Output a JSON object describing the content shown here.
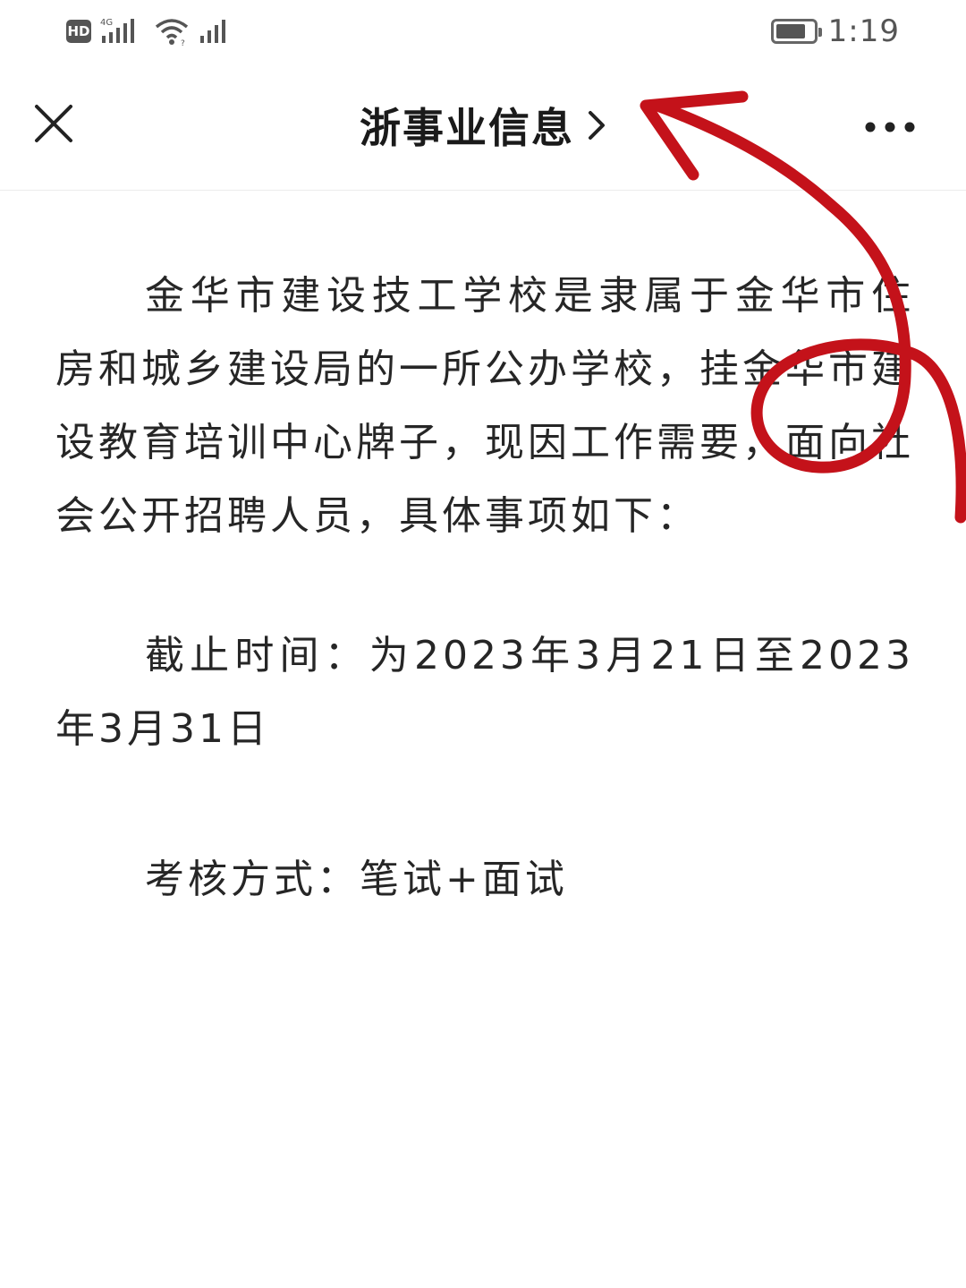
{
  "status_bar": {
    "hd_badge": "HD",
    "network": "4G",
    "time": "1:19",
    "battery_level": 0.8
  },
  "nav_bar": {
    "title": "浙事业信息",
    "close_icon": "close-icon",
    "chevron_icon": "chevron-right-icon",
    "more_icon": "more-icon"
  },
  "article": {
    "intro": "金华市建设技工学校是隶属于金华市住房和城乡建设局的一所公办学校，挂金华市建设教育培训中心牌子，现因工作需要，面向社会公开招聘人员，具体事项如下：",
    "deadline": "截止时间：为2023年3月21日至2023年3月31日",
    "assessment": "考核方式：笔试+面试"
  },
  "colors": {
    "annotation_red": "#c4121a",
    "text": "#262626",
    "title": "#1a1a1a"
  }
}
